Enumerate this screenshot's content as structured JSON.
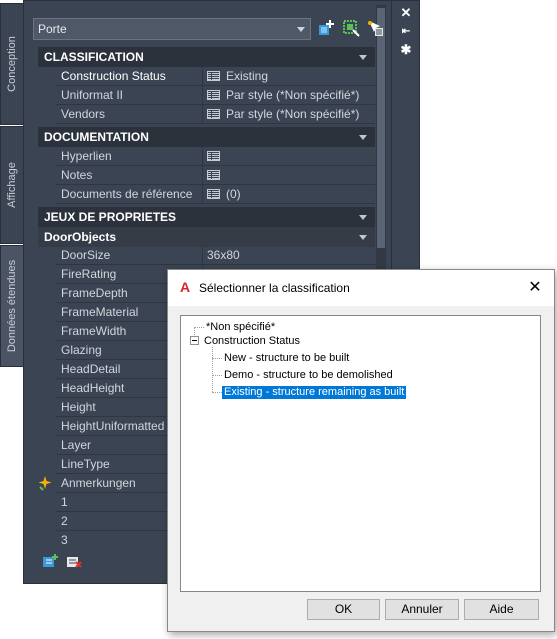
{
  "palette": {
    "tabs": [
      "Conception",
      "Affichage",
      "Données étendues"
    ],
    "object_select": "Porte",
    "sections": {
      "classification": {
        "title": "CLASSIFICATION",
        "rows": [
          {
            "label": "Construction Status",
            "value": "Existing"
          },
          {
            "label": "Uniformat II",
            "value": "Par style (*Non spécifié*)"
          },
          {
            "label": "Vendors",
            "value": "Par style (*Non spécifié*)"
          }
        ]
      },
      "documentation": {
        "title": "DOCUMENTATION",
        "rows": [
          {
            "label": "Hyperlien",
            "value": ""
          },
          {
            "label": "Notes",
            "value": ""
          },
          {
            "label": "Documents de référence",
            "value": "(0)"
          }
        ]
      },
      "property_sets": {
        "title": "JEUX DE PROPRIETES",
        "subsection": "DoorObjects",
        "rows": [
          {
            "label": "DoorSize",
            "value": "36x80"
          },
          {
            "label": "FireRating",
            "value": ""
          },
          {
            "label": "FrameDepth",
            "value": ""
          },
          {
            "label": "FrameMaterial",
            "value": ""
          },
          {
            "label": "FrameWidth",
            "value": ""
          },
          {
            "label": "Glazing",
            "value": ""
          },
          {
            "label": "HeadDetail",
            "value": ""
          },
          {
            "label": "HeadHeight",
            "value": ""
          },
          {
            "label": "Height",
            "value": ""
          },
          {
            "label": "HeightUniformatted",
            "value": ""
          },
          {
            "label": "Layer",
            "value": ""
          },
          {
            "label": "LineType",
            "value": ""
          },
          {
            "label": "Anmerkungen",
            "value": ""
          },
          {
            "label": "1",
            "value": ""
          },
          {
            "label": "2",
            "value": ""
          },
          {
            "label": "3",
            "value": ""
          }
        ]
      }
    }
  },
  "dialog": {
    "title": "Sélectionner la classification",
    "tree": {
      "root_unspecified": "*Non spécifié*",
      "group": "Construction Status",
      "children": [
        "New - structure to be built",
        "Demo - structure to be demolished",
        "Existing - structure remaining as built"
      ]
    },
    "buttons": {
      "ok": "OK",
      "cancel": "Annuler",
      "help": "Aide"
    }
  },
  "colors": {
    "panel_bg": "#3b4453",
    "section_bg": "#2c323c",
    "selection": "#0078d7",
    "dialog_bg": "#f0f0f0"
  }
}
